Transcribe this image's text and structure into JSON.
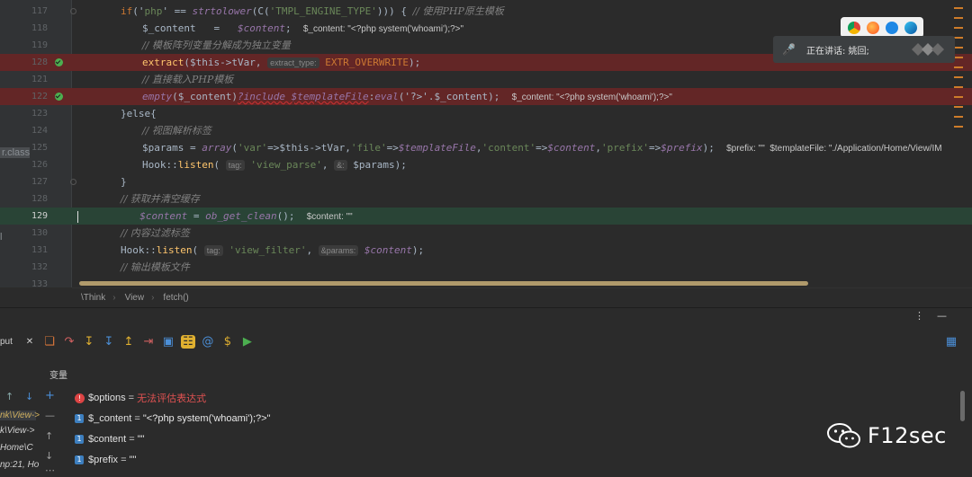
{
  "editor": {
    "left_fragments": [
      "r.class",
      "l"
    ],
    "lines": [
      {
        "n": "117",
        "state": "normal",
        "indent": 134,
        "tokens": [
          {
            "t": "if",
            "c": "kw"
          },
          {
            "t": "('",
            "c": "pl"
          },
          {
            "t": "php",
            "c": "str"
          },
          {
            "t": "' == ",
            "c": "pl"
          },
          {
            "t": "strtolower",
            "c": "va"
          },
          {
            "t": "(C(",
            "c": "pl"
          },
          {
            "t": "'TMPL_ENGINE_TYPE'",
            "c": "str"
          },
          {
            "t": "))) { ",
            "c": "pl"
          },
          {
            "t": "// 使用PHP原生模板",
            "c": "cm"
          }
        ]
      },
      {
        "n": "118",
        "state": "normal",
        "indent": 158,
        "tokens": [
          {
            "t": "$_content",
            "c": "pl"
          },
          {
            "t": "   =   ",
            "c": "pl"
          },
          {
            "t": "$content",
            "c": "va"
          },
          {
            "t": ";  ",
            "c": "pl"
          },
          {
            "t": "$_content: \"<?php system('whoami');?>\"",
            "c": "inl"
          }
        ]
      },
      {
        "n": "119",
        "state": "normal",
        "indent": 158,
        "tokens": [
          {
            "t": "// 模板阵列变量分解成为独立变量",
            "c": "cm"
          }
        ]
      },
      {
        "n": "128",
        "state": "breakpoint",
        "indent": 158,
        "tokens": [
          {
            "t": "extract",
            "c": "fn"
          },
          {
            "t": "($this->tVar, ",
            "c": "pl"
          },
          {
            "t": "extract_type:",
            "c": "hint"
          },
          {
            "t": " EXTR_OVERWRITE",
            "c": "kw"
          },
          {
            "t": ");",
            "c": "pl"
          }
        ]
      },
      {
        "n": "121",
        "state": "normal",
        "indent": 158,
        "tokens": [
          {
            "t": "// 直接载入PHP模板",
            "c": "cm"
          }
        ]
      },
      {
        "n": "122",
        "state": "breakpoint",
        "indent": 158,
        "tokens": [
          {
            "t": "empty",
            "c": "va"
          },
          {
            "t": "($_content)",
            "c": "pl"
          },
          {
            "t": "?include $templateFile",
            "c": "va"
          },
          {
            "t": ":",
            "c": "pl"
          },
          {
            "t": "eval",
            "c": "va"
          },
          {
            "t": "('?>'.$_content);  ",
            "c": "pl"
          },
          {
            "t": "$_content: \"<?php system('whoami');?>\"",
            "c": "inl"
          }
        ]
      },
      {
        "n": "123",
        "state": "normal",
        "indent": 134,
        "tokens": [
          {
            "t": "}else{",
            "c": "pl"
          }
        ]
      },
      {
        "n": "124",
        "state": "normal",
        "indent": 158,
        "tokens": [
          {
            "t": "// 视图解析标签",
            "c": "cm"
          }
        ]
      },
      {
        "n": "125",
        "state": "normal",
        "indent": 158,
        "tokens": [
          {
            "t": "$params",
            "c": "pl"
          },
          {
            "t": " = ",
            "c": "pl"
          },
          {
            "t": "array",
            "c": "va"
          },
          {
            "t": "(",
            "c": "pl"
          },
          {
            "t": "'var'",
            "c": "str"
          },
          {
            "t": "=>$this->tVar,",
            "c": "pl"
          },
          {
            "t": "'file'",
            "c": "str"
          },
          {
            "t": "=>",
            "c": "pl"
          },
          {
            "t": "$templateFile",
            "c": "va"
          },
          {
            "t": ",",
            "c": "pl"
          },
          {
            "t": "'content'",
            "c": "str"
          },
          {
            "t": "=>",
            "c": "pl"
          },
          {
            "t": "$content",
            "c": "va"
          },
          {
            "t": ",",
            "c": "pl"
          },
          {
            "t": "'prefix'",
            "c": "str"
          },
          {
            "t": "=>",
            "c": "pl"
          },
          {
            "t": "$prefix",
            "c": "va"
          },
          {
            "t": ");  ",
            "c": "pl"
          },
          {
            "t": "$prefix: \"\"  $templateFile: \"./Application/Home/View/IM",
            "c": "inl"
          }
        ]
      },
      {
        "n": "126",
        "state": "normal",
        "indent": 158,
        "tokens": [
          {
            "t": "Hook::",
            "c": "pl"
          },
          {
            "t": "listen",
            "c": "fn"
          },
          {
            "t": "( ",
            "c": "pl"
          },
          {
            "t": "tag:",
            "c": "hint"
          },
          {
            "t": " 'view_parse'",
            "c": "str"
          },
          {
            "t": ", ",
            "c": "pl"
          },
          {
            "t": "&:",
            "c": "hint"
          },
          {
            "t": " $params);",
            "c": "pl"
          }
        ]
      },
      {
        "n": "127",
        "state": "normal",
        "indent": 134,
        "tokens": [
          {
            "t": "}",
            "c": "pl"
          }
        ]
      },
      {
        "n": "128",
        "state": "normal",
        "indent": 134,
        "tokens": [
          {
            "t": "// 获取并清空缓存",
            "c": "cm"
          }
        ]
      },
      {
        "n": "129",
        "state": "current",
        "indent": 134,
        "tokens": [
          {
            "t": "$content",
            "c": "va"
          },
          {
            "t": " = ",
            "c": "pl"
          },
          {
            "t": "ob_get_clean",
            "c": "va"
          },
          {
            "t": "();  ",
            "c": "pl"
          },
          {
            "t": "$content: \"\"",
            "c": "inl"
          }
        ]
      },
      {
        "n": "130",
        "state": "normal",
        "indent": 134,
        "tokens": [
          {
            "t": "// 内容过滤标签",
            "c": "cm"
          }
        ]
      },
      {
        "n": "131",
        "state": "normal",
        "indent": 134,
        "tokens": [
          {
            "t": "Hook::",
            "c": "pl"
          },
          {
            "t": "listen",
            "c": "fn"
          },
          {
            "t": "( ",
            "c": "pl"
          },
          {
            "t": "tag:",
            "c": "hint"
          },
          {
            "t": " 'view_filter'",
            "c": "str"
          },
          {
            "t": ", ",
            "c": "pl"
          },
          {
            "t": "&params:",
            "c": "hint"
          },
          {
            "t": " $content",
            "c": "va"
          },
          {
            "t": ");",
            "c": "pl"
          }
        ]
      },
      {
        "n": "132",
        "state": "normal",
        "indent": 134,
        "tokens": [
          {
            "t": "// 输出模板文件",
            "c": "cm"
          }
        ]
      },
      {
        "n": "133",
        "state": "normal",
        "indent": 134,
        "tokens": []
      }
    ]
  },
  "notification": {
    "text": "正在讲话: 姚回;"
  },
  "breadcrumb": [
    "\\Think",
    "View",
    "fetch()"
  ],
  "panel": {
    "output_label": "put",
    "variables_title": "变量",
    "frames": [
      "nk\\View->",
      "k\\View->",
      "Home\\C",
      "np:21, Ho"
    ],
    "variables": [
      {
        "kind": "error",
        "name": "$options",
        "value": "无法评估表达式"
      },
      {
        "kind": "value",
        "name": "$_content",
        "value": "\"<?php system('whoami');?>\""
      },
      {
        "kind": "value",
        "name": "$content",
        "value": "\"\""
      },
      {
        "kind": "value",
        "name": "$prefix",
        "value": "\"\""
      }
    ]
  },
  "watermark": {
    "text": "F12sec"
  },
  "colors": {
    "breakpoint_line": "#632626",
    "current_line": "#294436",
    "accent": "#ce7c2a"
  }
}
